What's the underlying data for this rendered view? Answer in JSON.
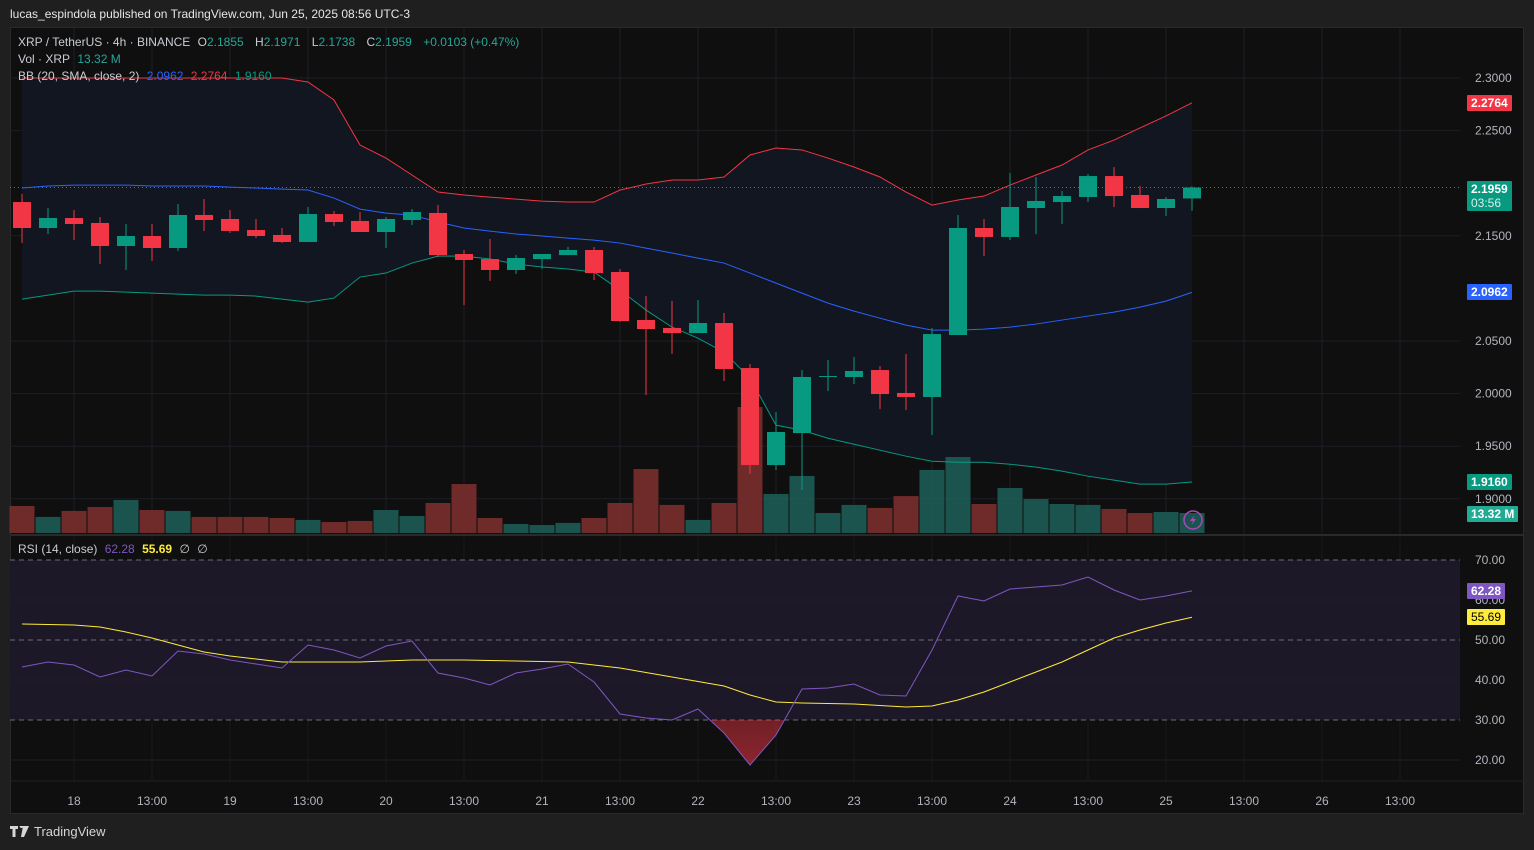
{
  "publisher_line": "lucas_espindola published on TradingView.com, Jun 25, 2025 08:56 UTC-3",
  "legend": {
    "symbol": "XRP / TetherUS · 4h · BINANCE",
    "o_label": "O",
    "o": "2.1855",
    "h_label": "H",
    "h": "2.1971",
    "l_label": "L",
    "l": "2.1738",
    "c_label": "C",
    "c": "2.1959",
    "change": "+0.0103 (+0.47%)",
    "vol_label": "Vol · XRP",
    "vol": "13.32 M",
    "bb_label": "BB (20, SMA, close, 2)",
    "bb_mid": "2.0962",
    "bb_upper": "2.2764",
    "bb_lower": "1.9160",
    "rsi_label": "RSI (14, close)",
    "rsi": "62.28",
    "rsi_ma": "55.69",
    "na1": "∅",
    "na2": "∅"
  },
  "tags": {
    "bb_upper": "2.2764",
    "price": "2.1959",
    "countdown": "03:56",
    "bb_mid": "2.0962",
    "bb_lower": "1.9160",
    "volume": "13.32 M",
    "rsi": "62.28",
    "rsi_ma": "55.69"
  },
  "colors": {
    "up": "#089981",
    "down": "#f23645",
    "bb_upper": "#f23645",
    "bb_mid": "#2962ff",
    "bb_lower": "#089981",
    "rsi": "#7e57c2",
    "rsi_ma": "#ffeb3b"
  },
  "footer": {
    "brand": "TradingView"
  },
  "chart_data": {
    "type": "candlestick",
    "title": "XRP / TetherUS · 4h · BINANCE",
    "ylim": [
      1.89,
      2.32
    ],
    "y_ticks": [
      "2.3000",
      "2.2500",
      "2.1500",
      "2.0500",
      "2.0000",
      "1.9500",
      "1.9000"
    ],
    "y_tick_values": [
      2.3,
      2.25,
      2.15,
      2.05,
      2.0,
      1.95,
      1.9
    ],
    "x_ticks": [
      {
        "label": "18",
        "index": 2
      },
      {
        "label": "13:00",
        "index": 5
      },
      {
        "label": "19",
        "index": 8
      },
      {
        "label": "13:00",
        "index": 11
      },
      {
        "label": "20",
        "index": 14
      },
      {
        "label": "13:00",
        "index": 17
      },
      {
        "label": "21",
        "index": 20
      },
      {
        "label": "13:00",
        "index": 23
      },
      {
        "label": "22",
        "index": 26
      },
      {
        "label": "13:00",
        "index": 29
      },
      {
        "label": "23",
        "index": 32
      },
      {
        "label": "13:00",
        "index": 35
      },
      {
        "label": "24",
        "index": 38
      },
      {
        "label": "13:00",
        "index": 41
      },
      {
        "label": "25",
        "index": 44
      },
      {
        "label": "13:00",
        "index": 47
      },
      {
        "label": "26",
        "index": 50
      },
      {
        "label": "13:00",
        "index": 53
      }
    ],
    "ohlc": [
      [
        2.1821,
        2.1898,
        2.1432,
        2.1574
      ],
      [
        2.1574,
        2.1764,
        2.1517,
        2.1669
      ],
      [
        2.1669,
        2.1745,
        2.146,
        2.1612
      ],
      [
        2.1622,
        2.1679,
        2.1232,
        2.1403
      ],
      [
        2.1403,
        2.1612,
        2.1175,
        2.1498
      ],
      [
        2.1498,
        2.1612,
        2.126,
        2.1384
      ],
      [
        2.1384,
        2.1802,
        2.1355,
        2.1698
      ],
      [
        2.1698,
        2.185,
        2.1546,
        2.165
      ],
      [
        2.166,
        2.1745,
        2.1527,
        2.1546
      ],
      [
        2.1555,
        2.166,
        2.1479,
        2.1498
      ],
      [
        2.1508,
        2.1574,
        2.1432,
        2.1441
      ],
      [
        2.1441,
        2.1774,
        2.1441,
        2.1707
      ],
      [
        2.1707,
        2.1736,
        2.1593,
        2.1631
      ],
      [
        2.1641,
        2.1726,
        2.1536,
        2.1536
      ],
      [
        2.1536,
        2.1679,
        2.1384,
        2.166
      ],
      [
        2.165,
        2.1755,
        2.1603,
        2.1726
      ],
      [
        2.1717,
        2.1793,
        2.1298,
        2.1317
      ],
      [
        2.1327,
        2.1365,
        2.0842,
        2.127
      ],
      [
        2.1279,
        2.147,
        2.107,
        2.1175
      ],
      [
        2.1175,
        2.1317,
        2.1137,
        2.1289
      ],
      [
        2.1279,
        2.1327,
        2.1184,
        2.1327
      ],
      [
        2.1317,
        2.1393,
        2.1317,
        2.1365
      ],
      [
        2.1365,
        2.1393,
        2.108,
        2.1146
      ],
      [
        2.1156,
        2.1184,
        2.0681,
        2.069
      ],
      [
        2.07,
        2.0928,
        1.9987,
        2.0614
      ],
      [
        2.0624,
        2.088,
        2.0376,
        2.0576
      ],
      [
        2.0576,
        2.089,
        2.0576,
        2.0671
      ],
      [
        2.0671,
        2.0766,
        2.012,
        2.0234
      ],
      [
        2.0243,
        2.0281,
        1.9236,
        1.9321
      ],
      [
        1.9321,
        1.9825,
        1.9274,
        1.9635
      ],
      [
        1.9625,
        2.0224,
        1.9084,
        2.0158
      ],
      [
        2.0162,
        2.0319,
        2.0025,
        2.0167
      ],
      [
        2.0158,
        2.0348,
        2.0091,
        2.0215
      ],
      [
        2.0224,
        2.0262,
        1.9854,
        1.9996
      ],
      [
        2.0006,
        2.0376,
        1.9844,
        1.9968
      ],
      [
        1.9968,
        2.0624,
        1.9606,
        2.0566
      ],
      [
        2.0557,
        2.1698,
        2.0557,
        2.1574
      ],
      [
        2.1574,
        2.166,
        2.1308,
        2.1489
      ],
      [
        2.1489,
        2.2097,
        2.146,
        2.1774
      ],
      [
        2.1764,
        2.2059,
        2.1517,
        2.1831
      ],
      [
        2.1821,
        2.1926,
        2.1612,
        2.1878
      ],
      [
        2.1869,
        2.2087,
        2.1821,
        2.2068
      ],
      [
        2.2068,
        2.2154,
        2.1774,
        2.1878
      ],
      [
        2.1888,
        2.1973,
        2.1764,
        2.1764
      ],
      [
        2.1764,
        2.1869,
        2.1688,
        2.185
      ],
      [
        2.1855,
        2.1971,
        2.1738,
        2.1959
      ]
    ],
    "volume_millions": [
      18.0,
      10.7,
      14.7,
      17.3,
      22.0,
      15.3,
      14.7,
      10.7,
      10.7,
      10.7,
      10.0,
      8.7,
      7.3,
      8.0,
      15.3,
      11.3,
      20.0,
      32.6,
      10.0,
      6.0,
      5.3,
      6.7,
      10.0,
      20.0,
      42.6,
      18.7,
      8.7,
      20.0,
      83.9,
      26.0,
      38.0,
      13.3,
      18.7,
      16.7,
      24.6,
      42.0,
      50.6,
      19.3,
      30.0,
      22.6,
      19.3,
      18.7,
      16.0,
      13.3,
      14.0,
      13.32
    ],
    "bb_upper": [
      2.3,
      2.3,
      2.3,
      2.3,
      2.3,
      2.3,
      2.3,
      2.3,
      2.3,
      2.3,
      2.3,
      2.2962,
      2.2791,
      2.2363,
      2.2239,
      2.2078,
      2.1916,
      2.1888,
      2.1868,
      2.1849,
      2.183,
      2.1821,
      2.1821,
      2.1935,
      2.1992,
      2.203,
      2.203,
      2.2059,
      2.2268,
      2.2335,
      2.2316,
      2.2239,
      2.2154,
      2.2059,
      2.1916,
      2.1792,
      2.184,
      2.1878,
      2.1982,
      2.2078,
      2.2173,
      2.2316,
      2.241,
      2.2525,
      2.2639,
      2.2764
    ],
    "bb_mid": [
      2.1954,
      2.1973,
      2.1982,
      2.1982,
      2.1982,
      2.1973,
      2.1973,
      2.1973,
      2.1963,
      2.1954,
      2.1944,
      2.1935,
      2.1859,
      2.1754,
      2.1716,
      2.1697,
      2.1631,
      2.1574,
      2.1545,
      2.1517,
      2.1498,
      2.1478,
      2.1459,
      2.1431,
      2.1383,
      2.1336,
      2.1288,
      2.1241,
      2.1146,
      2.105,
      2.0955,
      2.086,
      2.0784,
      2.0717,
      2.0651,
      2.0603,
      2.0603,
      2.0613,
      2.0632,
      2.0661,
      2.0699,
      2.0737,
      2.0775,
      2.0822,
      2.0879,
      2.0962
    ],
    "bb_lower": [
      2.0898,
      2.0936,
      2.0974,
      2.0974,
      2.0965,
      2.0955,
      2.0946,
      2.0936,
      2.0936,
      2.0927,
      2.0898,
      2.087,
      2.0908,
      2.1108,
      2.1146,
      2.1241,
      2.1307,
      2.1307,
      2.1279,
      2.1231,
      2.1203,
      2.1184,
      2.1155,
      2.0984,
      2.0794,
      2.0632,
      2.0527,
      2.0394,
      2.0147,
      1.97,
      1.9652,
      1.9576,
      1.9519,
      1.9462,
      1.9405,
      1.9357,
      1.9348,
      1.9348,
      1.9329,
      1.9301,
      1.9263,
      1.9215,
      1.9177,
      1.9139,
      1.9139,
      1.916
    ],
    "rsi": {
      "ylim": [
        15,
        75
      ],
      "ticks": [
        "70.00",
        "60.00",
        "50.00",
        "40.00",
        "30.00",
        "20.00"
      ],
      "tick_values": [
        70,
        60,
        50,
        40,
        30,
        20
      ],
      "bands": [
        30,
        50,
        70
      ],
      "values": [
        43.25,
        44.5,
        43.75,
        40.75,
        42.5,
        41,
        47.25,
        46.5,
        45,
        44,
        43,
        48.75,
        47.5,
        45.5,
        48.5,
        49.75,
        41.75,
        40.5,
        38.75,
        41.75,
        42.75,
        44,
        39.5,
        31.5,
        30.5,
        30,
        32.75,
        26.75,
        18.75,
        26.25,
        37.75,
        38,
        39,
        36.25,
        36,
        47.5,
        61,
        59.75,
        62.75,
        63.25,
        63.75,
        65.75,
        62.5,
        60,
        61,
        62.28
      ],
      "ma": [
        54,
        53.88,
        53.75,
        53.25,
        52,
        50.5,
        48.75,
        47,
        46,
        45.25,
        44.5,
        44.5,
        44.5,
        44.5,
        44.75,
        45,
        45,
        45,
        44.88,
        44.75,
        44.63,
        44.5,
        43.75,
        43,
        41.88,
        40.75,
        39.63,
        38.5,
        36.25,
        34.5,
        34.25,
        34.13,
        34,
        33.63,
        33.25,
        33.5,
        35,
        37,
        39.5,
        42,
        44.5,
        47.5,
        50.5,
        52.5,
        54.25,
        55.69
      ]
    }
  }
}
